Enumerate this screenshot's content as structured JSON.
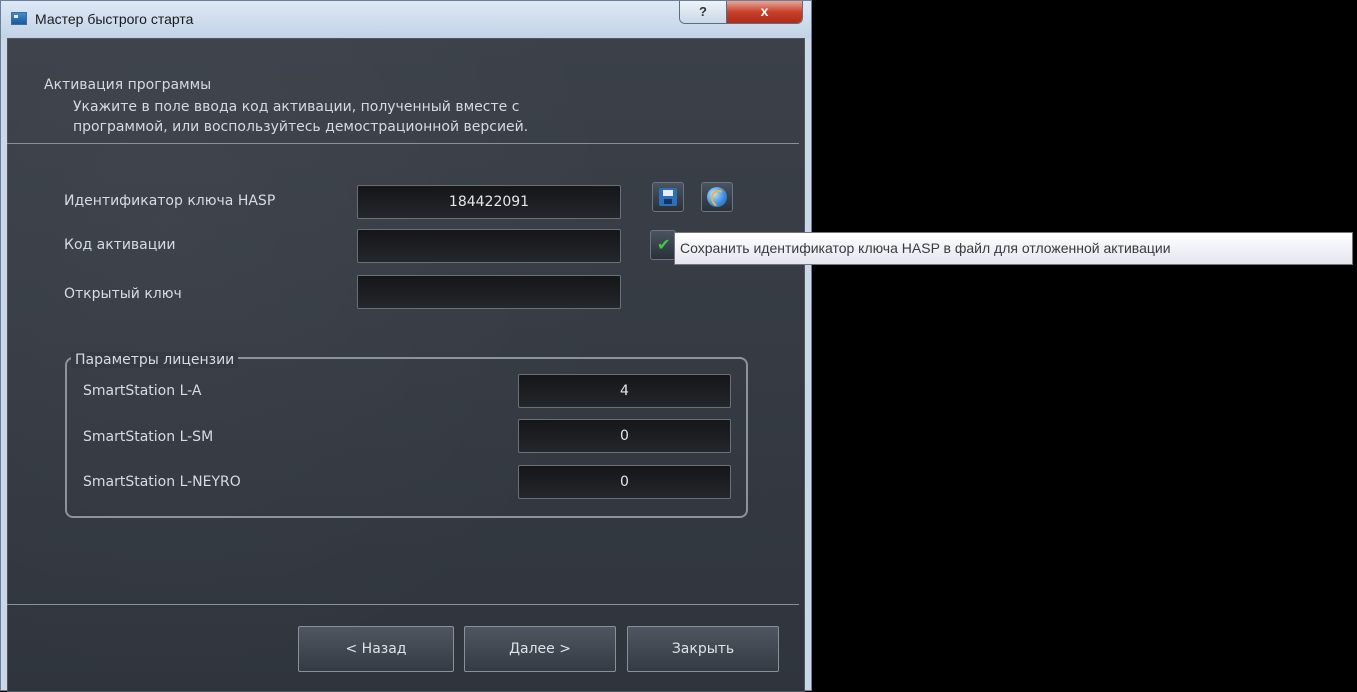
{
  "window": {
    "title": "Мастер быстрого старта",
    "help_label": "?",
    "close_label": "x"
  },
  "header": {
    "title": "Активация программы",
    "description_line1": "Укажите в поле ввода код активации, полученный вместе с",
    "description_line2": "программой, или воспользуйтесь демострационной версией."
  },
  "fields": {
    "hasp_label": "Идентификатор ключа HASP",
    "hasp_value": "184422091",
    "activation_label": "Код активации",
    "activation_value": "",
    "public_key_label": "Открытый ключ",
    "public_key_value": ""
  },
  "icons": {
    "save": "save-icon",
    "globe": "globe-icon",
    "check": "check-icon"
  },
  "tooltip": "Сохранить идентификатор ключа HASP в файл для отложенной активации",
  "license": {
    "title": "Параметры лицензии",
    "rows": [
      {
        "label": "SmartStation L-A",
        "value": "4"
      },
      {
        "label": "SmartStation L-SM",
        "value": "0"
      },
      {
        "label": "SmartStation L-NEYRO",
        "value": "0"
      }
    ]
  },
  "buttons": {
    "back": "< Назад",
    "next": "Далее >",
    "close": "Закрыть"
  },
  "colors": {
    "panel_bg": "#363b43",
    "field_bg": "#1b1d20",
    "accent_close": "#c7402a"
  }
}
